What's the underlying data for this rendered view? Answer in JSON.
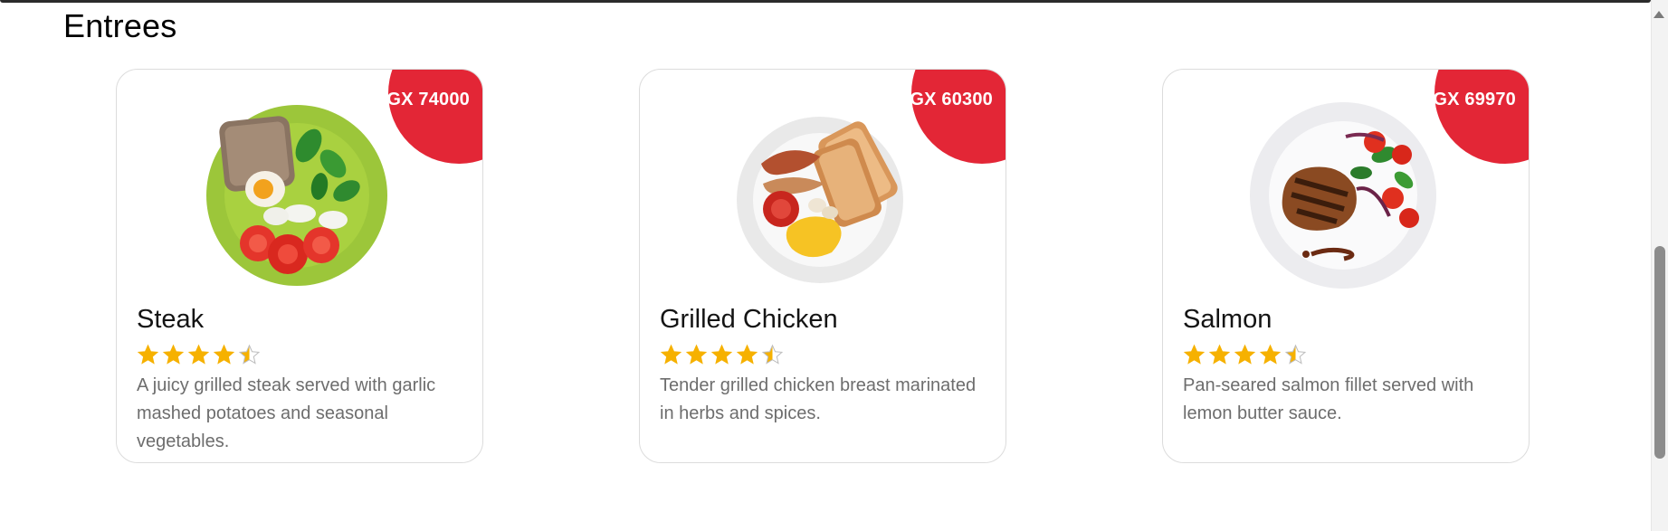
{
  "section": {
    "title": "Entrees"
  },
  "colors": {
    "accent": "#e32636",
    "star": "#f6b100",
    "star_empty": "#bdbdbd"
  },
  "cards": [
    {
      "name": "Steak",
      "price": "GX 74000",
      "rating": 4.5,
      "description": "A juicy grilled steak served with garlic mashed potatoes and seasonal vegetables.",
      "image": "steak-plate-image"
    },
    {
      "name": "Grilled Chicken",
      "price": "GX 60300",
      "rating": 4.5,
      "description": "Tender grilled chicken breast marinated in herbs and spices.",
      "image": "chicken-plate-image"
    },
    {
      "name": "Salmon",
      "price": "GX 69970",
      "rating": 4.5,
      "description": "Pan-seared salmon fillet served with lemon butter sauce.",
      "image": "salmon-plate-image"
    }
  ]
}
